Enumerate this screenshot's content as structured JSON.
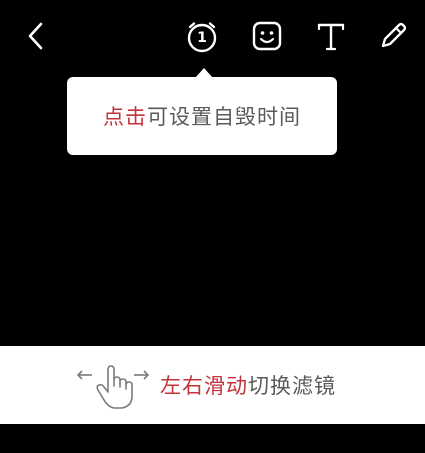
{
  "toolbar": {
    "timer_value": "1",
    "icon_color": "#ffffff"
  },
  "tooltip": {
    "highlight": "点击",
    "text": "可设置自毁时间"
  },
  "hint": {
    "highlight": "左右滑动",
    "text": "切换滤镜"
  },
  "colors": {
    "accent": "#c2343a",
    "text": "#5a5a5a",
    "background": "#000000",
    "panel": "#ffffff"
  }
}
